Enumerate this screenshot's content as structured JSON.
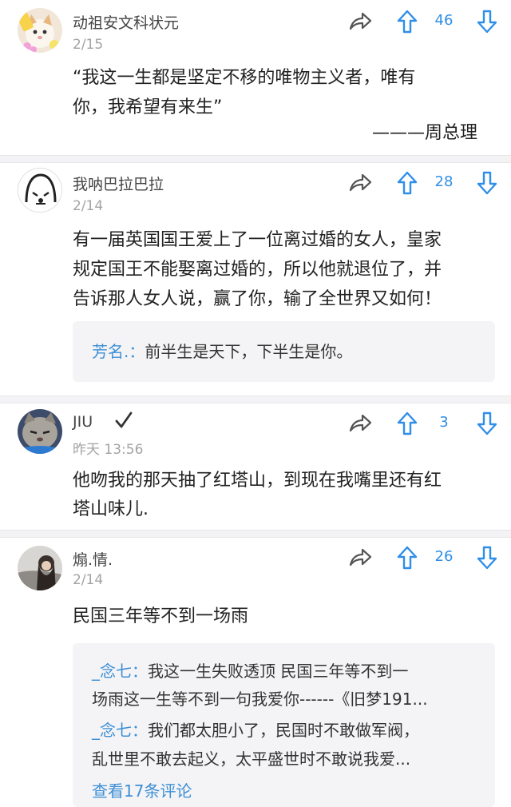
{
  "comments": [
    {
      "username": "动祖安文科状元",
      "date": "2/15",
      "votes": "46",
      "body": [
        "“我这一生都是坚定不移的唯物主义者，唯有",
        "你，我希望有来生”",
        "———周总理"
      ],
      "avatar_icon": "cat-avatar-icon"
    },
    {
      "username": "我呐巴拉巴拉",
      "date": "2/14",
      "votes": "28",
      "body": [
        "有一届英国国王爱上了一位离过婚的女人，皇家",
        "规定国王不能娶离过婚的，所以他就退位了，并",
        "告诉那人女人说，赢了你，输了全世界又如何！"
      ],
      "replies": [
        {
          "name": "芳名.：",
          "text": "前半生是天下，下半生是你。"
        }
      ],
      "avatar_icon": "sketch-face-avatar-icon"
    },
    {
      "username": "JIU",
      "date": "昨天 13:56",
      "votes": "3",
      "body": [
        "他吻我的那天抽了红塔山，到现在我嘴里还有红",
        "塔山味儿."
      ],
      "avatar_icon": "cat-photo-avatar-icon"
    },
    {
      "username": "煽.情.",
      "date": "2/14",
      "votes": "26",
      "body": [
        "民国三年等不到一场雨"
      ],
      "replies": [
        {
          "name": "_念七：",
          "text": "我这一生失败透顶  民国三年等不到一"
        },
        {
          "name": "",
          "text": "场雨这一生等不到一句我爱你------《旧梦191..."
        },
        {
          "name": "_念七：",
          "text": "我们都太胆小了，民国时不敢做军阀，"
        },
        {
          "name": "",
          "text": "乱世里不敢去起义，太平盛世时不敢说我爱..."
        }
      ],
      "view_more": "查看17条评论",
      "avatar_icon": "girl-photo-avatar-icon"
    }
  ],
  "colors": {
    "accent": "#2f8ee8",
    "link": "#3d8fd6",
    "muted": "#a3a3a3",
    "icon": "#555555"
  }
}
